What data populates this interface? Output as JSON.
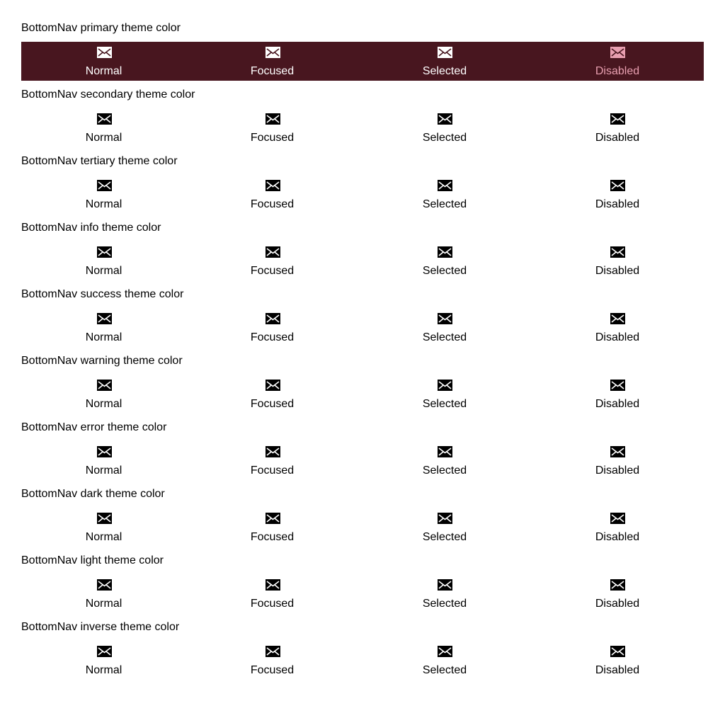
{
  "nav_states": [
    "Normal",
    "Focused",
    "Selected",
    "Disabled"
  ],
  "sections": [
    {
      "title": "BottomNav primary theme color",
      "items": [
        "Normal",
        "Focused",
        "Selected",
        "Disabled"
      ]
    },
    {
      "title": "BottomNav secondary theme color",
      "items": [
        "Normal",
        "Focused",
        "Selected",
        "Disabled"
      ]
    },
    {
      "title": "BottomNav tertiary theme color",
      "items": [
        "Normal",
        "Focused",
        "Selected",
        "Disabled"
      ]
    },
    {
      "title": "BottomNav info theme color",
      "items": [
        "Normal",
        "Focused",
        "Selected",
        "Disabled"
      ]
    },
    {
      "title": "BottomNav success theme color",
      "items": [
        "Normal",
        "Focused",
        "Selected",
        "Disabled"
      ]
    },
    {
      "title": "BottomNav warning theme color",
      "items": [
        "Normal",
        "Focused",
        "Selected",
        "Disabled"
      ]
    },
    {
      "title": "BottomNav error theme color",
      "items": [
        "Normal",
        "Focused",
        "Selected",
        "Disabled"
      ]
    },
    {
      "title": "BottomNav dark theme color",
      "items": [
        "Normal",
        "Focused",
        "Selected",
        "Disabled"
      ]
    },
    {
      "title": "BottomNav light theme color",
      "items": [
        "Normal",
        "Focused",
        "Selected",
        "Disabled"
      ]
    },
    {
      "title": "BottomNav inverse theme color",
      "items": [
        "Normal",
        "Focused",
        "Selected",
        "Disabled"
      ]
    }
  ],
  "icon": "envelope-icon",
  "colors": {
    "primary_nav_bg": "#48161f",
    "primary_label": "#ffffff",
    "primary_disabled": "#e89fb0",
    "default_label": "#000000"
  }
}
